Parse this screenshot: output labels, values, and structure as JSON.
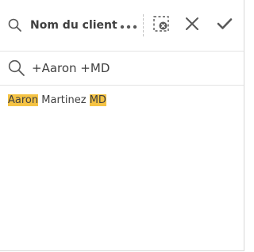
{
  "header": {
    "title": "Nom du client",
    "icons": {
      "search": "search-icon",
      "more": "more-horizontal-icon",
      "clear": "clear-selection-icon",
      "cancel": "close-icon",
      "confirm": "checkmark-icon"
    }
  },
  "search": {
    "value": "+Aaron +MD",
    "icon": "search-icon"
  },
  "list": {
    "items": [
      {
        "match1": "Aaron",
        "middle": " Martinez ",
        "match2": "MD"
      }
    ]
  },
  "colors": {
    "highlight": "#f5c344",
    "text": "#404040",
    "divider": "#e4e4e4"
  }
}
